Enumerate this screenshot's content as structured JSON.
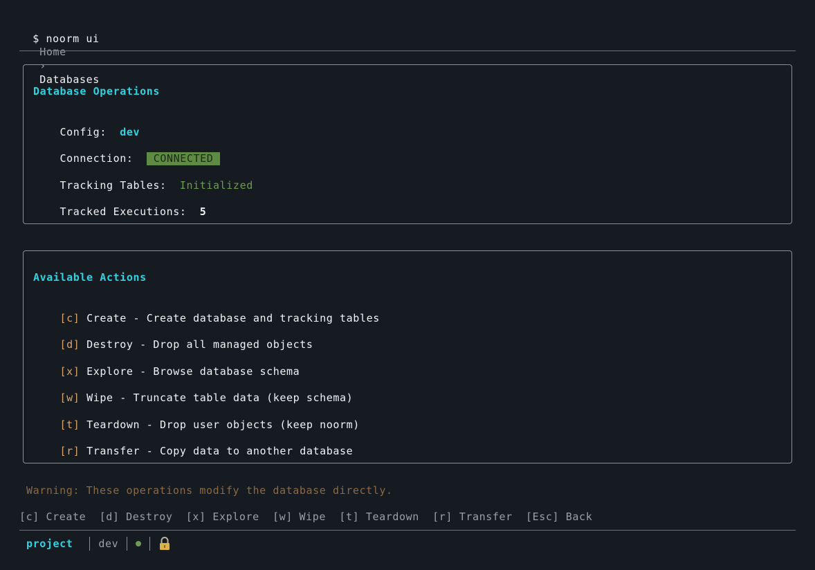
{
  "prompt": {
    "symbol": "$",
    "command": "noorm ui"
  },
  "breadcrumb": {
    "home": "Home",
    "separator": "›",
    "current": "Databases"
  },
  "operations_panel": {
    "title": "Database Operations",
    "config_label": "Config:",
    "config_value": "dev",
    "connection_label": "Connection:",
    "connection_value": "CONNECTED",
    "tracking_label": "Tracking Tables:",
    "tracking_value": "Initialized",
    "executions_label": "Tracked Executions:",
    "executions_value": "5"
  },
  "actions_panel": {
    "title": "Available Actions",
    "items": [
      {
        "key": "[c]",
        "text": "Create - Create database and tracking tables"
      },
      {
        "key": "[d]",
        "text": "Destroy - Drop all managed objects"
      },
      {
        "key": "[x]",
        "text": "Explore - Browse database schema"
      },
      {
        "key": "[w]",
        "text": "Wipe - Truncate table data (keep schema)"
      },
      {
        "key": "[t]",
        "text": "Teardown - Drop user objects (keep noorm)"
      },
      {
        "key": "[r]",
        "text": "Transfer - Copy data to another database"
      }
    ]
  },
  "warning": "Warning: These operations modify the database directly.",
  "shortcuts": [
    "[c] Create",
    "[d] Destroy",
    "[x] Explore",
    "[w] Wipe",
    "[t] Teardown",
    "[r] Transfer",
    "[Esc] Back"
  ],
  "status_bar": {
    "project": "project",
    "config": "dev",
    "connection_icon": "status-dot-icon",
    "lock_icon": "lock-icon"
  },
  "colors": {
    "background": "#161a21",
    "accent": "#2fd3e0",
    "success": "#6e9a52",
    "key": "#d8a56c",
    "warning": "#8b6a45"
  }
}
